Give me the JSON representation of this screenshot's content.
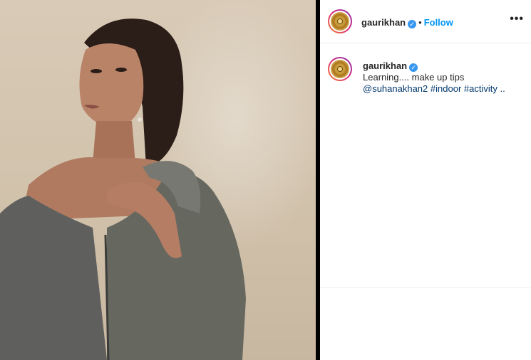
{
  "post": {
    "author": {
      "username": "gaurikhan",
      "verified_icon": "verified-badge-icon",
      "avatar_icon": "gold-record-avatar-icon"
    },
    "header": {
      "separator": "•",
      "follow_label": "Follow",
      "more_label": "•••"
    },
    "caption": {
      "username": "gaurikhan",
      "text": "Learning.... make up tips",
      "mention": "@suhanakhan2",
      "tag1": "#indoor",
      "tag2": "#activity ..",
      "verified_icon": "verified-badge-icon"
    },
    "colors": {
      "follow_blue": "#0095f6",
      "link_blue": "#00376b",
      "verified_blue": "#3897f0"
    }
  }
}
